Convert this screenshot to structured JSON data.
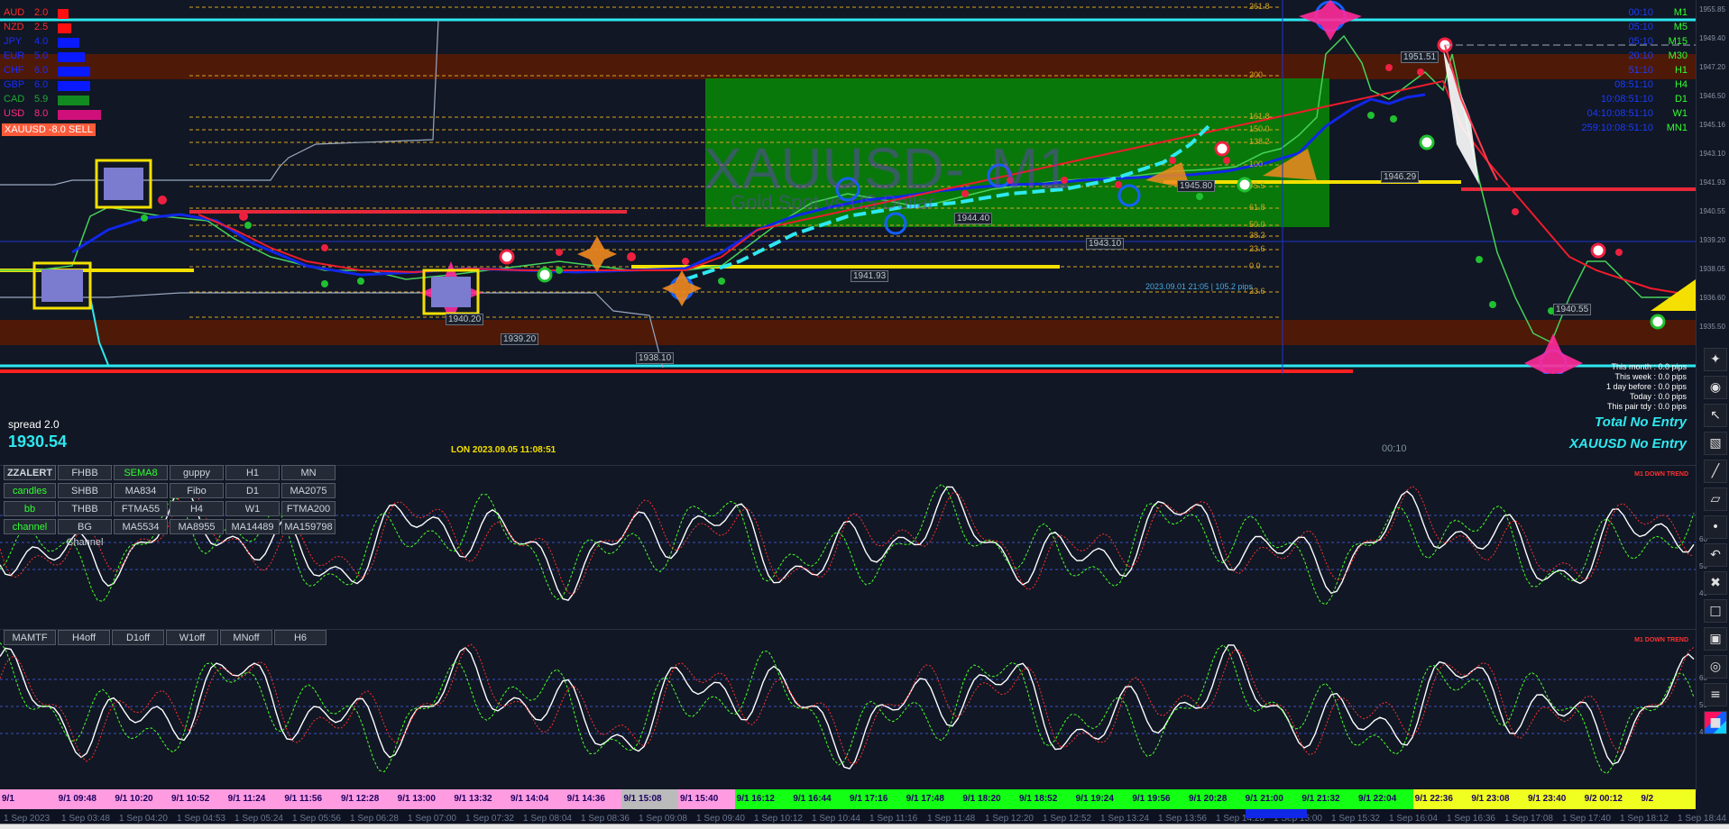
{
  "currency_strength": [
    {
      "code": "AUD",
      "value": "2.0",
      "color": "#ff2a2a",
      "bar_color": "#ff1010",
      "level": 0.2
    },
    {
      "code": "NZD",
      "value": "2.5",
      "color": "#ff2a2a",
      "bar_color": "#ff1010",
      "level": 0.25
    },
    {
      "code": "JPY",
      "value": "4.0",
      "color": "#1a2bff",
      "bar_color": "#0a1aff",
      "level": 0.4
    },
    {
      "code": "EUR",
      "value": "5.0",
      "color": "#1a2bff",
      "bar_color": "#0a1aff",
      "level": 0.5
    },
    {
      "code": "CHF",
      "value": "6.0",
      "color": "#1a2bff",
      "bar_color": "#0a1aff",
      "level": 0.6
    },
    {
      "code": "GBP",
      "value": "6.0",
      "color": "#1a2bff",
      "bar_color": "#0a1aff",
      "level": 0.6
    },
    {
      "code": "CAD",
      "value": "5.9",
      "color": "#1faa35",
      "bar_color": "#138a20",
      "level": 0.59
    },
    {
      "code": "USD",
      "value": "8.0",
      "color": "#ff2a80",
      "bar_color": "#d0107a",
      "level": 0.8
    }
  ],
  "signal": {
    "text": "XAUUSD -8.0 SELL",
    "color": "#ff4b3a"
  },
  "watermark": {
    "symbol": "XAUUSD",
    "timeframe": "M1",
    "subtitle": "Gold Spot vs US Dollar"
  },
  "spread": {
    "label": "spread 2.0",
    "price": "1930.54"
  },
  "timeframe_table": [
    {
      "time": "00:10",
      "tf": "M1"
    },
    {
      "time": "05:10",
      "tf": "M5"
    },
    {
      "time": "05:10",
      "tf": "M15"
    },
    {
      "time": "20:10",
      "tf": "M30"
    },
    {
      "time": "51:10",
      "tf": "H1"
    },
    {
      "time": "08:51:10",
      "tf": "H4"
    },
    {
      "time": "10:08:51:10",
      "tf": "D1"
    },
    {
      "time": "04:10:08:51:10",
      "tf": "W1"
    },
    {
      "time": "259:10:08:51:10",
      "tf": "MN1"
    }
  ],
  "fib_levels": [
    "261.8",
    "200",
    "161.8",
    "150.0",
    "138.2",
    "100",
    "75.5",
    "61.8",
    "50.0",
    "38.2",
    "23.6",
    "0.0",
    "23.6"
  ],
  "price_tags": [
    "1951.51",
    "1946.29",
    "1945.80",
    "1944.40",
    "1943.10",
    "1941.93",
    "1940.55",
    "1940.20",
    "1939.20",
    "1938.10"
  ],
  "stats": {
    "this_month": "This month : 0.0 pips",
    "this_week": "This week : 0.0 pips",
    "day_before": "1 day before : 0.0 pips",
    "today": "Today : 0.0 pips",
    "this_pair": "This pair tdy : 0.0 pips"
  },
  "no_entry": {
    "total": "Total No Entry",
    "pair": "XAUUSD No Entry"
  },
  "session_label": "LON 2023.09.05 11:08:51",
  "fibo_info": "2023.09.01 21:05 | 105.2 pips",
  "timer": "00:10",
  "down_trend": "M1 DOWN TREND",
  "panel_a_buttons": [
    [
      "ZZALERT",
      "FHBB",
      "SEMA8",
      "guppy",
      "H1",
      "MN"
    ],
    [
      "candles",
      "SHBB",
      "MA834",
      "Fibo",
      "D1",
      "MA2075"
    ],
    [
      "bb",
      "THBB",
      "FTMA55",
      "H4",
      "W1",
      "FTMA200"
    ],
    [
      "channel",
      "BG Channel",
      "MA5534",
      "MA8955",
      "MA14489",
      "MA159798"
    ]
  ],
  "panel_b_buttons": [
    "MAMTF",
    "H4off",
    "D1off",
    "W1off",
    "MNoff",
    "H6"
  ],
  "price_axis": [
    "1955.85",
    "1949.40",
    "1947.20",
    "1946.50",
    "1945.16",
    "1943.10",
    "1941.93",
    "1940.55",
    "1939.20",
    "1938.05",
    "1936.60",
    "1935.50"
  ],
  "osc_axis": [
    "60",
    "50",
    "40"
  ],
  "session_times": [
    {
      "t": "9/1",
      "c": "#ff9be0"
    },
    {
      "t": "9/1 09:48",
      "c": "#ff9be0"
    },
    {
      "t": "9/1 10:20",
      "c": "#ff9be0"
    },
    {
      "t": "9/1 10:52",
      "c": "#ff9be0"
    },
    {
      "t": "9/1 11:24",
      "c": "#ff9be0"
    },
    {
      "t": "9/1 11:56",
      "c": "#ff9be0"
    },
    {
      "t": "9/1 12:28",
      "c": "#ff9be0"
    },
    {
      "t": "9/1 13:00",
      "c": "#ff9be0"
    },
    {
      "t": "9/1 13:32",
      "c": "#ff9be0"
    },
    {
      "t": "9/1 14:04",
      "c": "#ff9be0"
    },
    {
      "t": "9/1 14:36",
      "c": "#ff9be0"
    },
    {
      "t": "9/1 15:08",
      "c": "#bbbbbb"
    },
    {
      "t": "9/1 15:40",
      "c": "#ff9be0"
    },
    {
      "t": "9/1 16:12",
      "c": "#13ff13"
    },
    {
      "t": "9/1 16:44",
      "c": "#13ff13"
    },
    {
      "t": "9/1 17:16",
      "c": "#13ff13"
    },
    {
      "t": "9/1 17:48",
      "c": "#13ff13"
    },
    {
      "t": "9/1 18:20",
      "c": "#13ff13"
    },
    {
      "t": "9/1 18:52",
      "c": "#13ff13"
    },
    {
      "t": "9/1 19:24",
      "c": "#13ff13"
    },
    {
      "t": "9/1 19:56",
      "c": "#13ff13"
    },
    {
      "t": "9/1 20:28",
      "c": "#13ff13"
    },
    {
      "t": "9/1 21:00",
      "c": "#13ff13"
    },
    {
      "t": "9/1 21:32",
      "c": "#13ff13"
    },
    {
      "t": "9/1 22:04",
      "c": "#13ff13"
    },
    {
      "t": "9/1 22:36",
      "c": "#f0ff20"
    },
    {
      "t": "9/1 23:08",
      "c": "#f0ff20"
    },
    {
      "t": "9/1 23:40",
      "c": "#f0ff20"
    },
    {
      "t": "9/2 00:12",
      "c": "#f0ff20"
    },
    {
      "t": "9/2",
      "c": "#f0ff20"
    }
  ],
  "time_axis": [
    "1 Sep 2023",
    "1 Sep 03:48",
    "1 Sep 04:20",
    "1 Sep 04:53",
    "1 Sep 05:24",
    "1 Sep 05:56",
    "1 Sep 06:28",
    "1 Sep 07:00",
    "1 Sep 07:32",
    "1 Sep 08:04",
    "1 Sep 08:36",
    "1 Sep 09:08",
    "1 Sep 09:40",
    "1 Sep 10:12",
    "1 Sep 10:44",
    "1 Sep 11:16",
    "1 Sep 11:48",
    "1 Sep 12:20",
    "1 Sep 12:52",
    "1 Sep 13:24",
    "1 Sep 13:56",
    "1 Sep 14:28",
    "1 Sep 15:00",
    "1 Sep 15:32",
    "1 Sep 16:04",
    "1 Sep 16:36",
    "1 Sep 17:08",
    "1 Sep 17:40",
    "1 Sep 18:12",
    "1 Sep 18:44"
  ],
  "toolbar_icons": [
    "lightbulb-icon",
    "eye-icon",
    "cursor-icon",
    "eraser-icon",
    "pen-icon",
    "ruler-icon",
    "dot-icon",
    "undo-icon",
    "trash-icon",
    "monitor-icon",
    "monitor2-icon",
    "camera-icon",
    "clipboard-icon",
    "palette-icon"
  ]
}
